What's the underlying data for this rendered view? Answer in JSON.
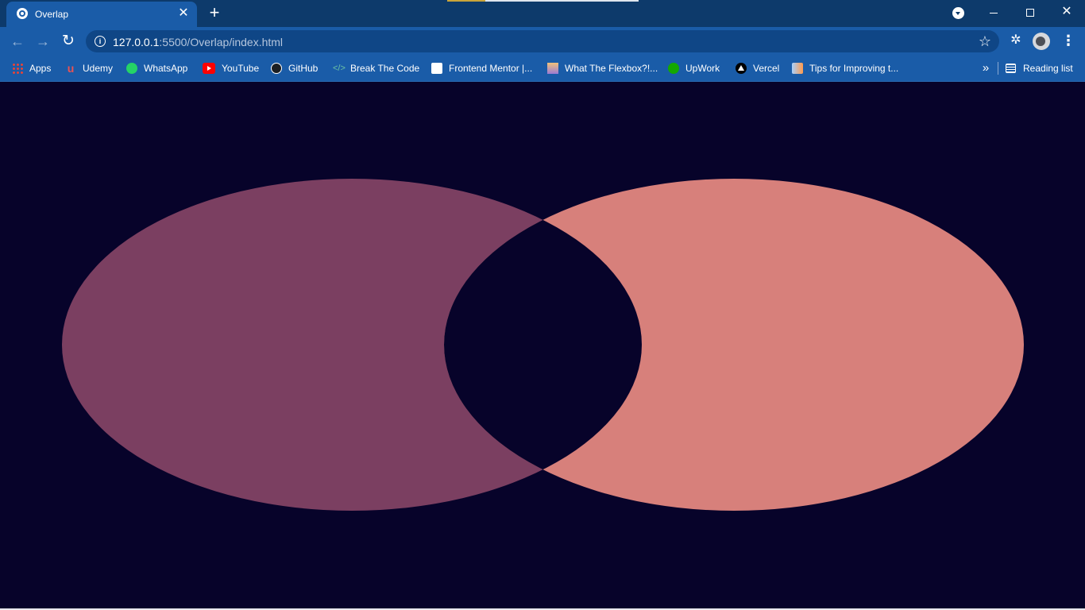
{
  "tab": {
    "title": "Overlap",
    "close_glyph": "✕",
    "favicon": "globe-icon"
  },
  "newtab_glyph": "+",
  "window_controls": {
    "close_glyph": "✕"
  },
  "toolbar": {
    "back_glyph": "←",
    "forward_glyph": "→",
    "reload_glyph": "↻",
    "info_glyph": "i",
    "url_host": "127.0.0.1",
    "url_path": ":5500/Overlap/index.html",
    "star_glyph": "☆",
    "extensions_glyph": "✲",
    "menu_glyph": "⋮"
  },
  "bookmarks": {
    "items": [
      {
        "label": "Apps",
        "icon": "apps-icon"
      },
      {
        "label": "Udemy",
        "icon": "udemy-icon"
      },
      {
        "label": "WhatsApp",
        "icon": "whatsapp-icon"
      },
      {
        "label": "YouTube",
        "icon": "youtube-icon"
      },
      {
        "label": "GitHub",
        "icon": "github-icon"
      },
      {
        "label": "Break The Code",
        "icon": "code-icon"
      },
      {
        "label": "Frontend Mentor |...",
        "icon": "frontend-mentor-icon"
      },
      {
        "label": "What The Flexbox?!...",
        "icon": "flexbox-icon"
      },
      {
        "label": "UpWork",
        "icon": "upwork-icon"
      },
      {
        "label": "Vercel",
        "icon": "vercel-icon"
      },
      {
        "label": "Tips for Improving t...",
        "icon": "tips-icon"
      }
    ],
    "more_glyph": "»",
    "reading_list": "Reading list",
    "udemy_glyph": "u",
    "code_glyph": "</>"
  },
  "colors": {
    "page_background": "#07032a",
    "left_circle": "#7b3f61",
    "right_circle": "#d7807b",
    "overlap": "#07032a",
    "browser_frame": "#1a5ca8",
    "tab_strip": "#0d3a6b"
  }
}
